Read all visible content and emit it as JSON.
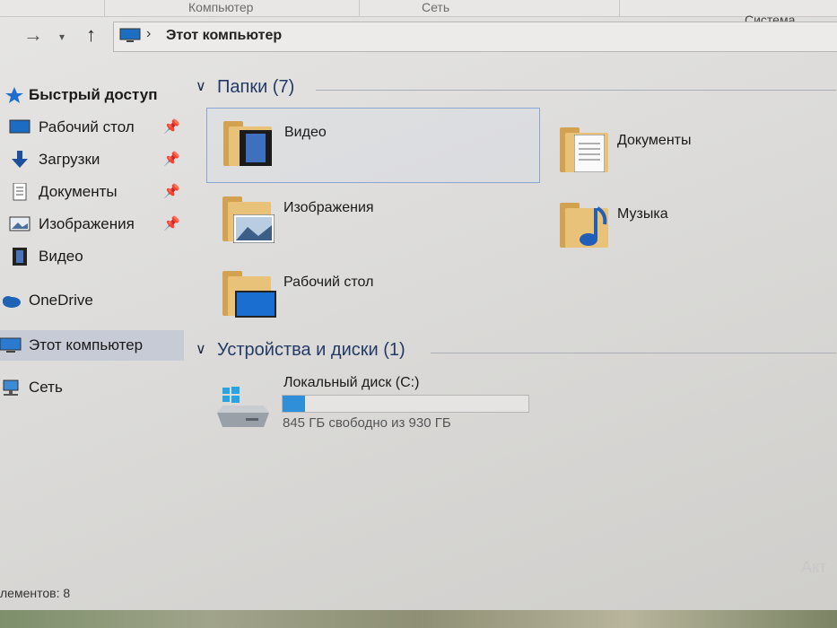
{
  "ribbon": {
    "tab_left": "Компьютер",
    "tab_center": "Сеть",
    "system": "Система"
  },
  "address": {
    "path": "Этот компьютер"
  },
  "sidebar": {
    "items": [
      {
        "label": "Быстрый доступ",
        "icon": "star-icon",
        "pinned": false
      },
      {
        "label": "Рабочий стол",
        "icon": "desktop-icon",
        "pinned": true
      },
      {
        "label": "Загрузки",
        "icon": "download-arrow-icon",
        "pinned": true
      },
      {
        "label": "Документы",
        "icon": "document-icon",
        "pinned": true
      },
      {
        "label": "Изображения",
        "icon": "pictures-icon",
        "pinned": true
      },
      {
        "label": "Видео",
        "icon": "film-icon",
        "pinned": false
      },
      {
        "label": "OneDrive",
        "icon": "cloud-icon",
        "pinned": false
      },
      {
        "label": "Этот компьютер",
        "icon": "computer-icon",
        "pinned": false,
        "selected": true
      },
      {
        "label": "Сеть",
        "icon": "network-icon",
        "pinned": false
      }
    ]
  },
  "folders_section": {
    "title": "Папки (7)"
  },
  "folders": [
    {
      "label": "Видео",
      "overlay": "film-icon"
    },
    {
      "label": "Документы",
      "overlay": "document-icon"
    },
    {
      "label": "Изображения",
      "overlay": "landscape-icon"
    },
    {
      "label": "Музыка",
      "overlay": "music-note-icon"
    },
    {
      "label": "Рабочий стол",
      "overlay": "desktop-icon"
    }
  ],
  "devices_section": {
    "title": "Устройства и диски (1)"
  },
  "drive": {
    "label": "Локальный диск (C:)",
    "free_text": "845 ГБ свободно из 930 ГБ",
    "used_fraction": 0.091
  },
  "status": {
    "items": "лементов: 8"
  },
  "watermark": "Акт",
  "colors": {
    "accent": "#2f8fd8",
    "folder": "#e9c27a",
    "selected": "#c6cbd6"
  }
}
